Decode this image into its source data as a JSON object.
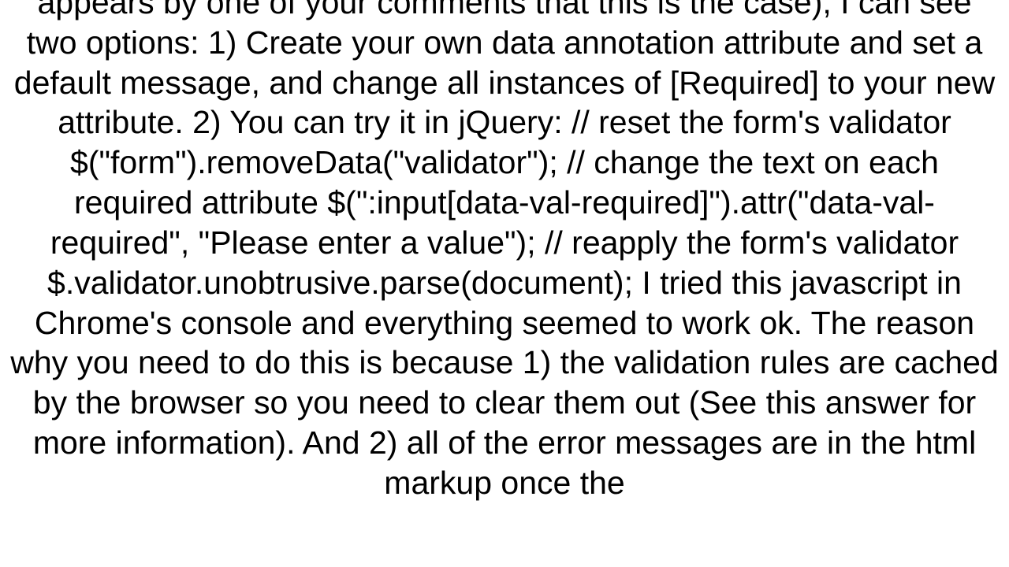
{
  "body": {
    "text": "appears by one of your comments that this is the case), I can see two options: 1) Create your own data annotation attribute and set a default message, and change all instances of [Required] to your new attribute. 2) You can try it in jQuery: // reset the form's validator $(\"form\").removeData(\"validator\");  // change the text on each required attribute $(\":input[data-val-required]\").attr(\"data-val-required\", \"Please enter a value\");  // reapply the form's validator $.validator.unobtrusive.parse(document);  I tried this javascript in Chrome's console and everything seemed to work ok. The reason why you need to do this is because 1) the validation rules are cached by the browser so you need to clear them out (See this answer for more information). And 2) all of the error messages are in the html markup once the"
  }
}
